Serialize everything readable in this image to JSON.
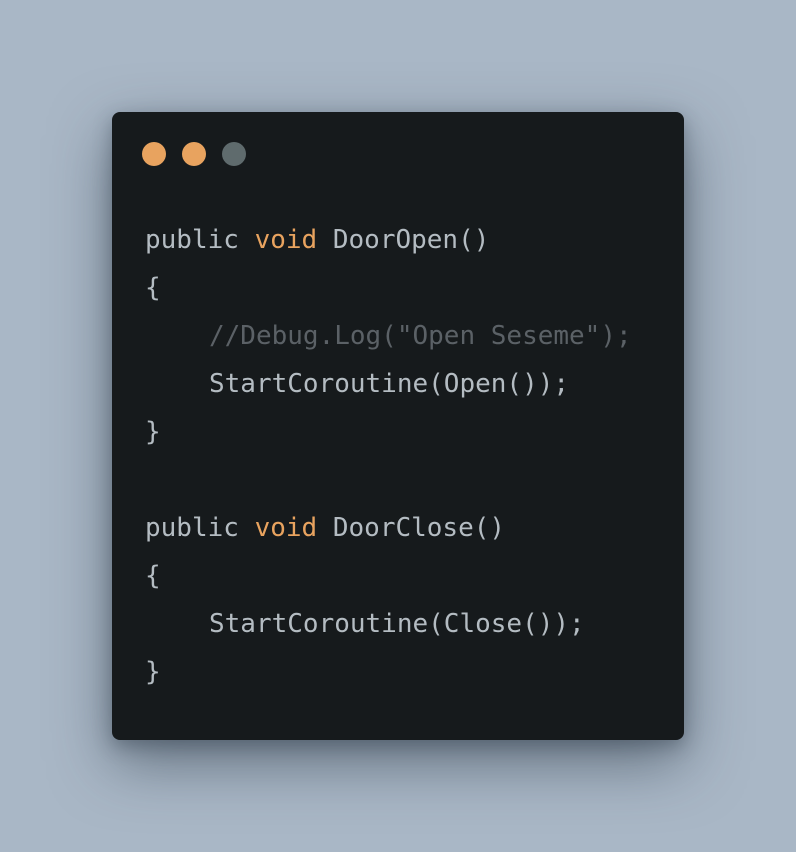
{
  "window": {
    "dots": [
      {
        "name": "close-dot",
        "color": "#e8a35f"
      },
      {
        "name": "minimize-dot",
        "color": "#e8a35f"
      },
      {
        "name": "maximize-dot",
        "color": "#5f6b6d"
      }
    ]
  },
  "colors": {
    "background": "#a9b7c6",
    "window": "#161a1c",
    "text": "#b4bcc2",
    "keyword": "#e8a35f",
    "comment": "#5b6166"
  },
  "code": {
    "method1": {
      "kw_public": "public",
      "kw_void": "void",
      "signature": "DoorOpen()",
      "open_brace": "{",
      "comment": "//Debug.Log(\"Open Seseme\");",
      "statement": "StartCoroutine(Open());",
      "close_brace": "}"
    },
    "method2": {
      "kw_public": "public",
      "kw_void": "void",
      "signature": "DoorClose()",
      "open_brace": "{",
      "statement": "StartCoroutine(Close());",
      "close_brace": "}"
    }
  }
}
